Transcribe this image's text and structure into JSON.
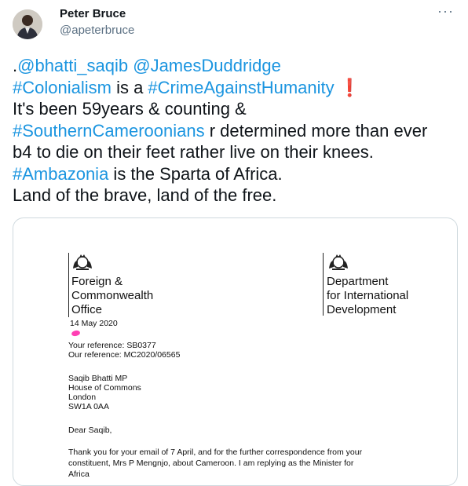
{
  "tweet": {
    "author_name": "Peter Bruce",
    "author_handle": "@apeterbruce",
    "more_glyph": "···",
    "mention_prefix": ".",
    "mention_1": "@bhatti_saqib",
    "mention_2": "@JamesDuddridge",
    "hashtag_colonialism": "#Colonialism",
    "text_is_a": " is a ",
    "hashtag_crime": "#CrimeAgainstHumanity",
    "exclamation": " ❗",
    "line_3": "It's been 59years & counting &",
    "hashtag_southern": "#SouthernCameroonians",
    "line_4_rest": " r determined more than ever",
    "line_5": "b4 to die on their feet rather live on their knees.",
    "hashtag_ambazonia": "#Ambazonia",
    "line_6_rest": " is the Sparta of Africa.",
    "line_7": "Land of the brave, land of the free."
  },
  "letter": {
    "fco_lines": [
      "Foreign &",
      "Commonwealth",
      "Office"
    ],
    "dfid_lines": [
      "Department",
      "for International",
      "Development"
    ],
    "date": "14 May 2020",
    "your_reference": "Your reference: SB0377",
    "our_reference": "Our reference: MC2020/06565",
    "address": [
      "Saqib Bhatti MP",
      "House of Commons",
      "London",
      "SW1A 0AA"
    ],
    "salutation": "Dear Saqib,",
    "body_lines": [
      "Thank you for your email of 7 April, and for the further correspondence from your",
      "constituent, Mrs P Mengnjo, about Cameroon. I am replying as the Minister for",
      "Africa"
    ]
  },
  "colors": {
    "link": "#1b95e0",
    "text": "#0f1419",
    "secondary": "#5b7083",
    "border": "#cfd9de",
    "highlight_pink": "#ff3fb4"
  },
  "icons": [
    "avatar-photo",
    "more-options-icon",
    "royal-crest-icon",
    "exclamation-emoji"
  ]
}
